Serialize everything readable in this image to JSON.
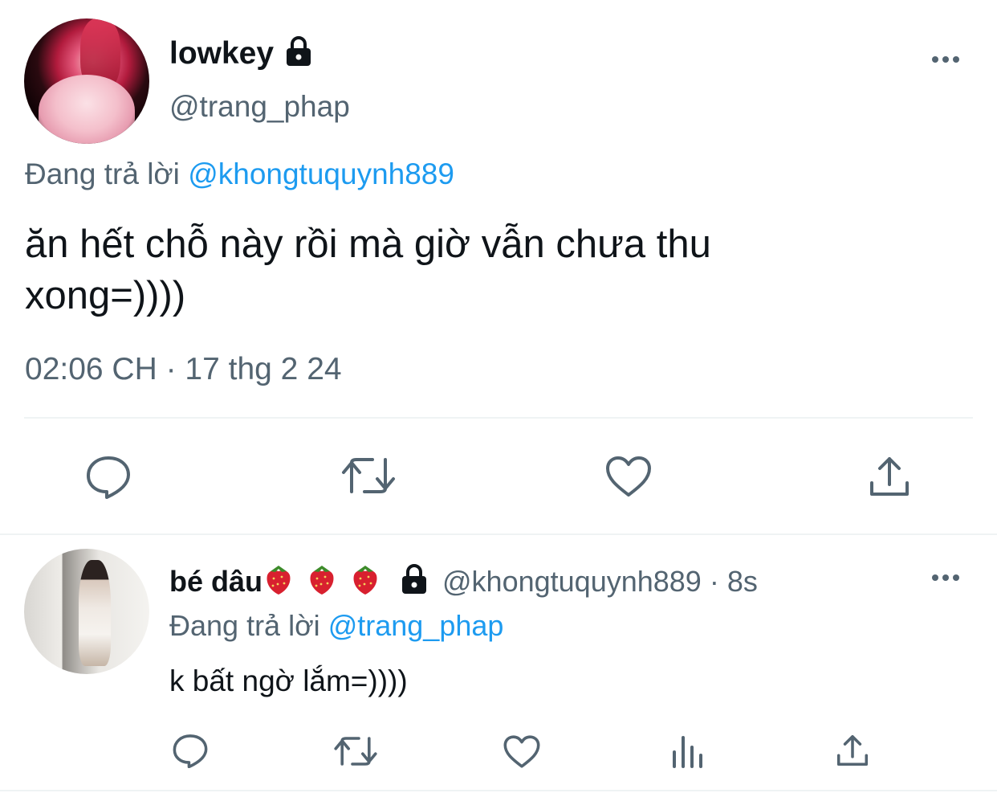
{
  "main_tweet": {
    "display_name": "lowkey",
    "handle": "@trang_phap",
    "replying_prefix": "Đang trả lời",
    "replying_to": "@khongtuquynh889",
    "text_line1": "ăn hết chỗ này rồi mà giờ vẫn chưa thu",
    "text_line2": "xong=))))",
    "timestamp": "02:06 CH · 17 thg 2 24"
  },
  "reply_tweet": {
    "display_name": "bé dâu",
    "handle": "@khongtuquynh889",
    "time_ago": "· 8s",
    "replying_prefix": "Đang trả lời",
    "replying_to": "@trang_phap",
    "text": "k bất ngờ lắm=))))"
  },
  "icons": {
    "lock": "lock-icon",
    "more": "more-icon",
    "reply": "reply-icon",
    "retweet": "retweet-icon",
    "like": "heart-icon",
    "share": "share-icon",
    "analytics": "analytics-icon",
    "emoji": "strawberry-icon"
  },
  "colors": {
    "text": "#0f1419",
    "muted": "#536471",
    "link": "#1d9bf0",
    "divider": "#eff3f4"
  }
}
